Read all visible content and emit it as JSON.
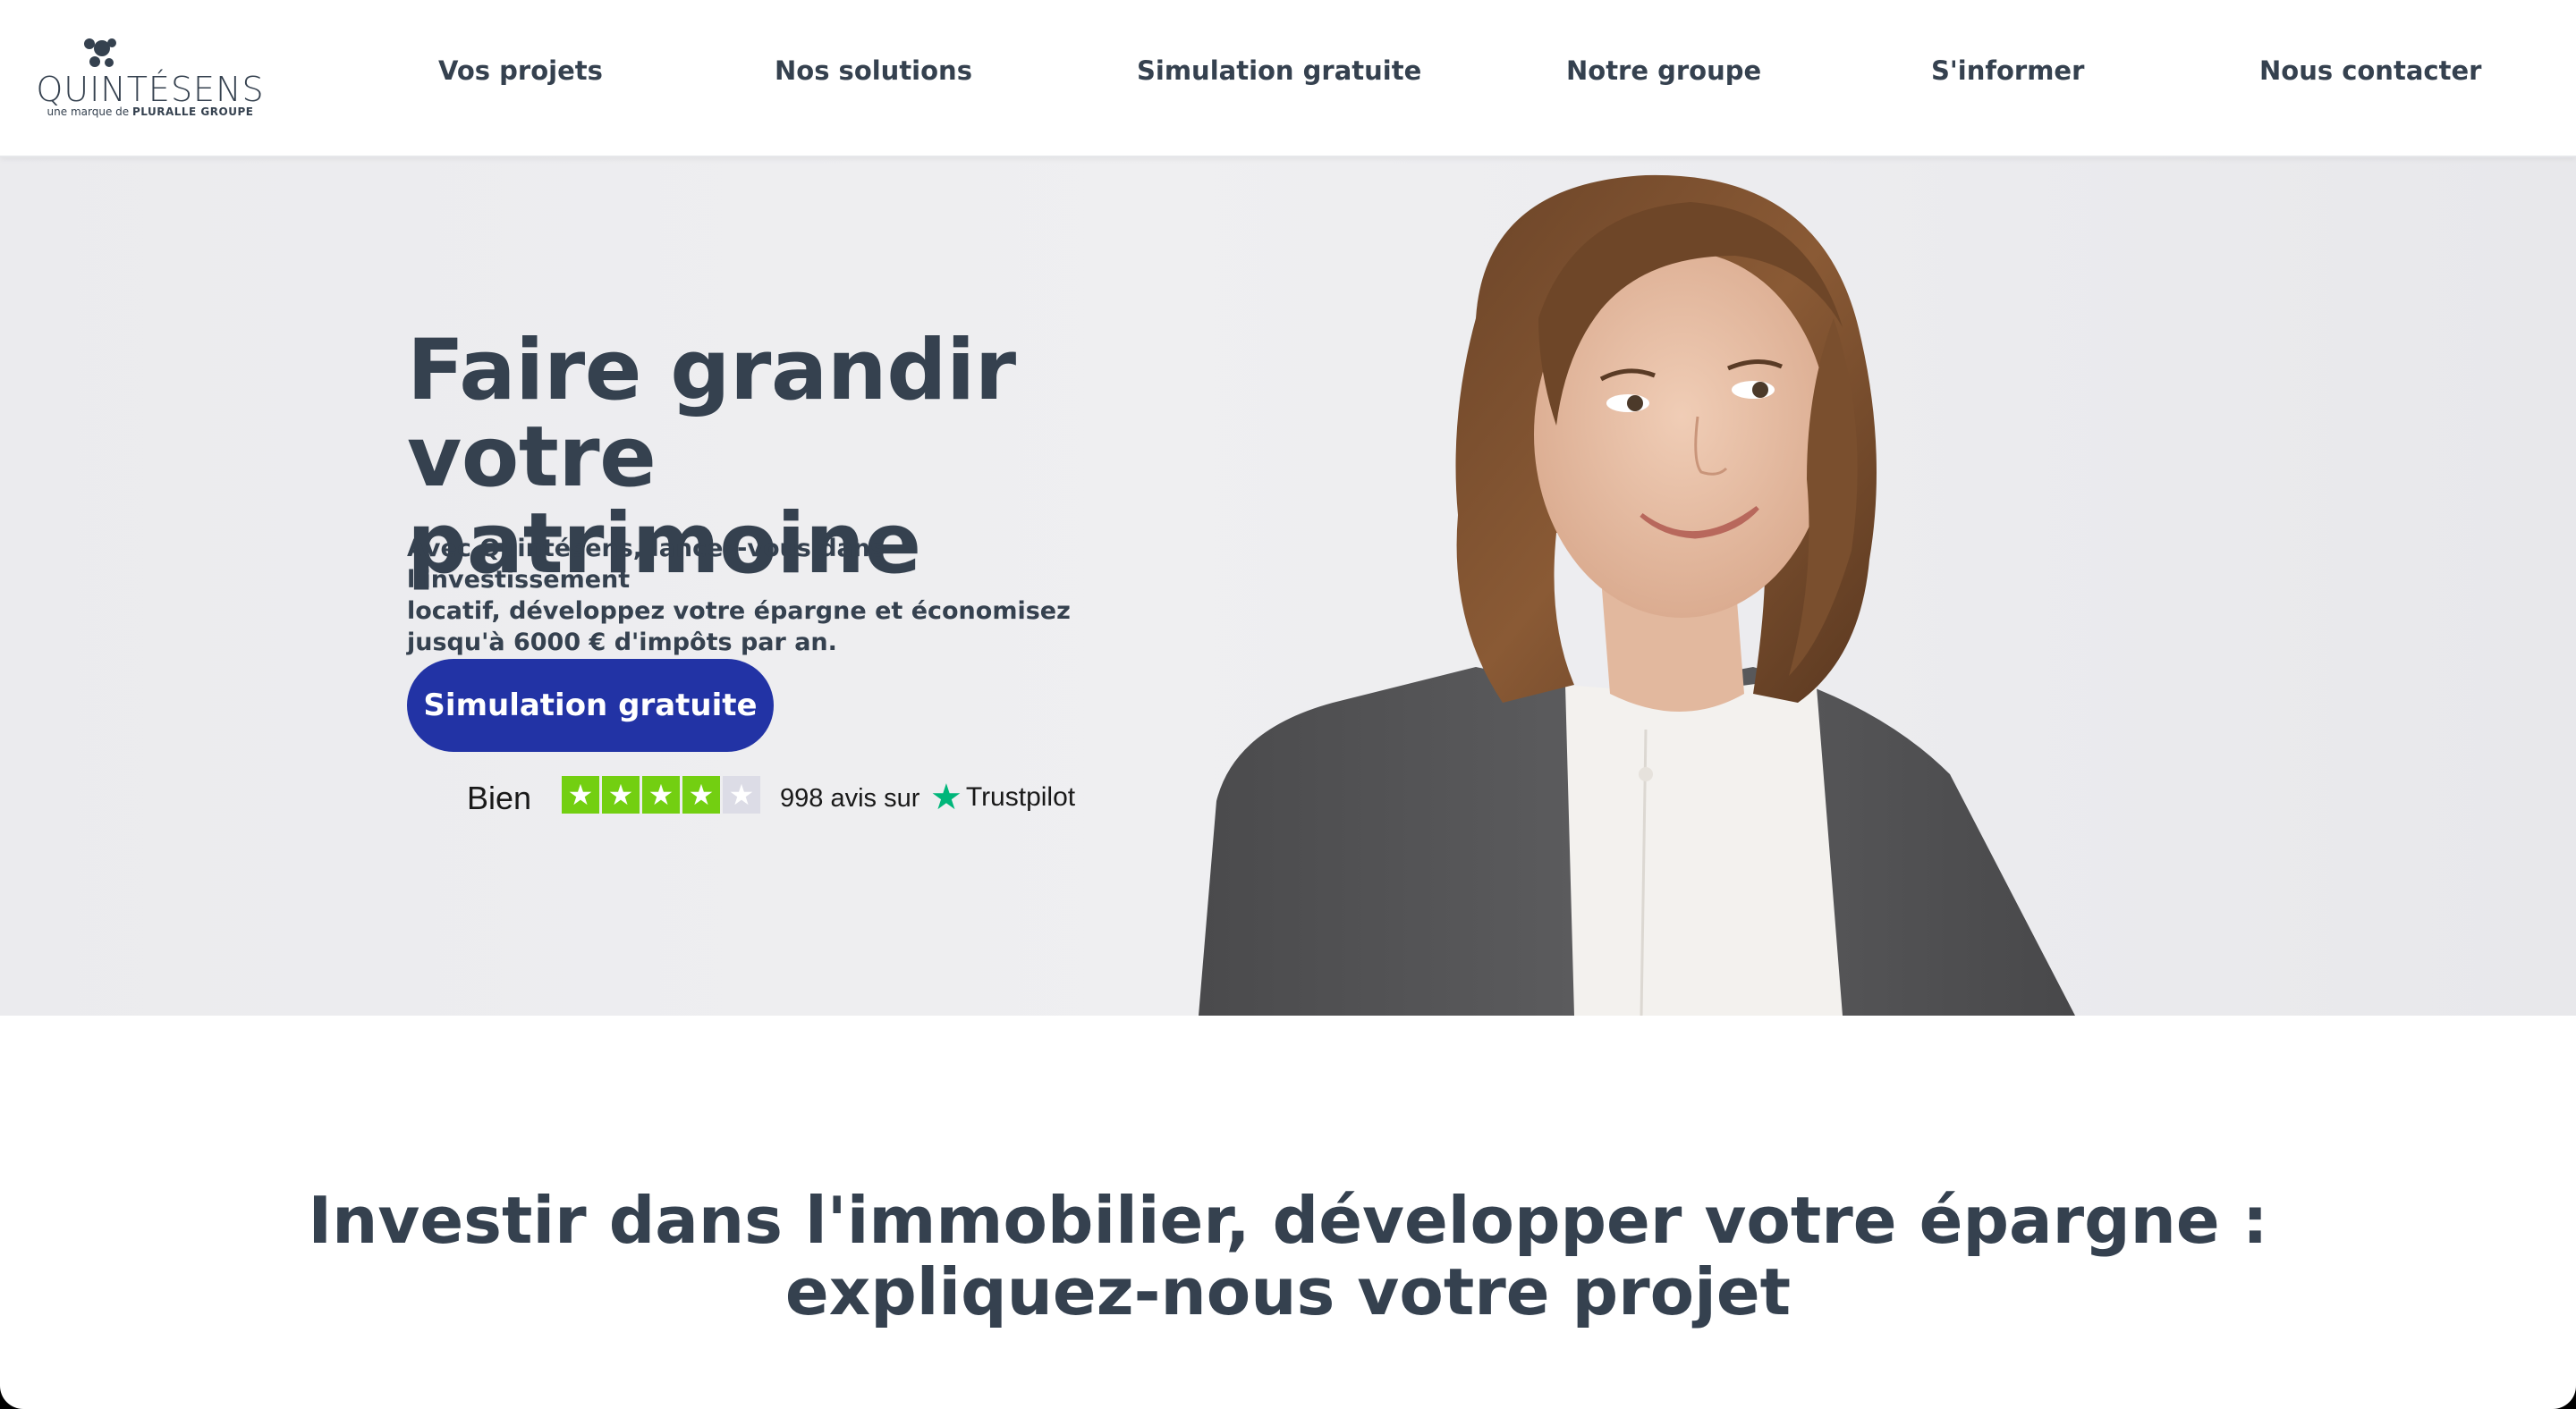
{
  "brand": {
    "name": "QUINTÉSENS",
    "tagline_prefix": "une marque de",
    "tagline_group": "PLURALLE GROUPE"
  },
  "nav": {
    "items": [
      "Vos projets",
      "Nos solutions",
      "Simulation gratuite",
      "Notre groupe",
      "S'informer",
      "Nous contacter"
    ]
  },
  "hero": {
    "title_line1": "Faire grandir votre",
    "title_line2": "patrimoine",
    "description_line1": "Avec Quintésens, lancez-vous dans l'investissement",
    "description_line2": "locatif, développez votre épargne et économisez",
    "description_line3": "jusqu'à 6000 € d'impôts par an.",
    "cta_label": "Simulation gratuite"
  },
  "trustpilot": {
    "rating_label": "Bien",
    "stars_filled": 4,
    "stars_total": 5,
    "review_text": "998 avis sur",
    "brand": "Trustpilot"
  },
  "section": {
    "title_line1": "Investir dans l'immobilier, développer votre épargne :",
    "title_line2": "expliquez-nous votre projet"
  },
  "colors": {
    "text": "#35414f",
    "cta": "#2233a5",
    "trustpilot_green": "#73cf11",
    "trustpilot_brand": "#00b67a"
  }
}
